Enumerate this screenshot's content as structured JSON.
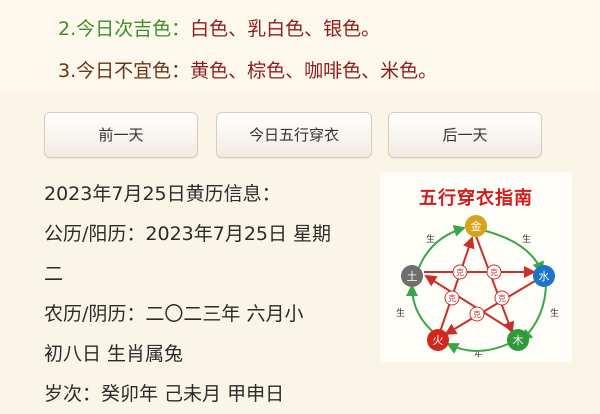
{
  "colors": {
    "good_label": "2.今日次吉色：",
    "good_values": "白色、乳白色、银色。",
    "bad_label": "3.今日不宜色：",
    "bad_values": "黄色、棕色、咖啡色、米色。"
  },
  "nav": {
    "prev": "前一天",
    "today": "今日五行穿衣",
    "next": "后一天"
  },
  "info": {
    "heading": "2023年7月25日黄历信息：",
    "solar_line1": "公历/阳历：2023年7月25日 星期",
    "solar_line2": "二",
    "lunar_line1": "农历/阴历：二〇二三年 六月小",
    "lunar_line2": "初八日 生肖属兔",
    "ganzhi": "岁次：癸卯年 己未月 甲申日"
  },
  "wuxing_guide": {
    "title": "五行穿衣指南",
    "elements": {
      "metal": "金",
      "water": "水",
      "wood": "木",
      "fire": "火",
      "earth": "土"
    },
    "generate": "生",
    "overcome": "克",
    "element_colors": {
      "metal": "#d8a21a",
      "water": "#1e74c8",
      "wood": "#2e9a3a",
      "fire": "#d2261e",
      "earth": "#6e6e6e"
    }
  }
}
